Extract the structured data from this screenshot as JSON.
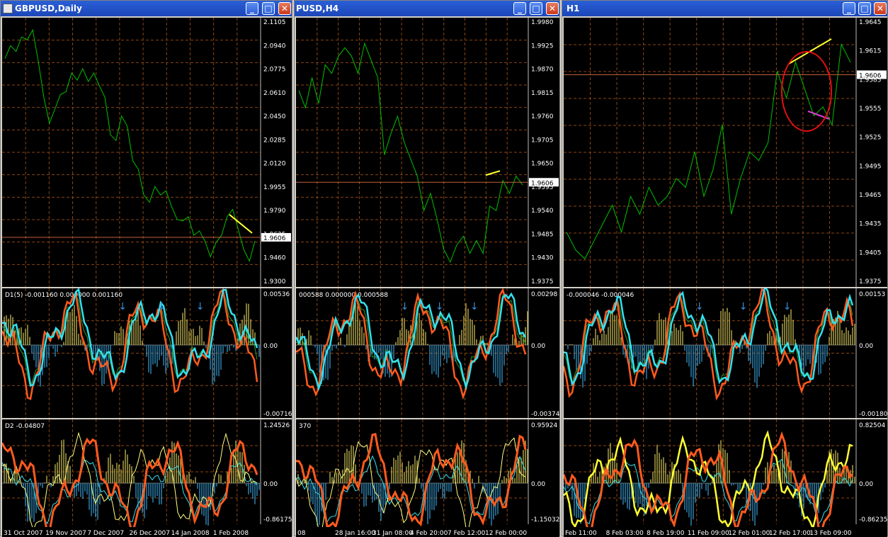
{
  "windows": [
    {
      "title": "GBPUSD,Daily",
      "price_axis": [
        "2.1105",
        "2.0940",
        "2.0775",
        "2.0610",
        "2.0450",
        "2.0285",
        "2.0120",
        "1.9955",
        "1.9790",
        "1.9625",
        "1.9460",
        "1.9300"
      ],
      "current_price": "1.9606",
      "ind1": {
        "label": "D1(5) -0.001160 0.000000 0.001160",
        "top": "0.00536",
        "zero": "0.00",
        "bottom": "-0.00716"
      },
      "ind2": {
        "label": "D2 -0.04807",
        "top": "1.24526",
        "zero": "0.00",
        "bottom": "-0.86175"
      },
      "time_axis": [
        "31 Oct 2007",
        "19 Nov 2007",
        "7 Dec 2007",
        "26 Dec 2007",
        "14 Jan 2008",
        "1 Feb 2008"
      ]
    },
    {
      "title": "PUSD,H4",
      "price_axis": [
        "1.9980",
        "1.9925",
        "1.9870",
        "1.9815",
        "1.9760",
        "1.9705",
        "1.9650",
        "1.9595",
        "1.9540",
        "1.9485",
        "1.9430",
        "1.9375"
      ],
      "current_price": "1.9606",
      "ind1": {
        "label": "000588 0.000000 0.000588",
        "top": "0.00298",
        "zero": "0.00",
        "bottom": "-0.00374"
      },
      "ind2": {
        "label": "370",
        "top": "0.95924",
        "zero": "0.00",
        "bottom": "-1.15032"
      },
      "time_axis": [
        "08",
        "28 Jan 16:00",
        "31 Jan 08:00",
        "4 Feb 20:00",
        "7 Feb 12:00",
        "12 Feb 00:00"
      ]
    },
    {
      "title": "H1",
      "price_axis": [
        "1.9645",
        "1.9615",
        "1.9585",
        "1.9555",
        "1.9525",
        "1.9495",
        "1.9465",
        "1.9435",
        "1.9405",
        "1.9375"
      ],
      "current_price": "1.9606",
      "ind1": {
        "label": "-0.000046 -0.000046",
        "top": "0.00153",
        "zero": "0.00",
        "bottom": "-0.00180"
      },
      "ind2": {
        "label": "",
        "top": "0.82504",
        "zero": "0.00",
        "bottom": "-0.86235"
      },
      "time_axis": [
        "Feb 11:00",
        "8 Feb 03:00",
        "8 Feb 19:00",
        "11 Feb 09:00",
        "12 Feb 01:00",
        "12 Feb 17:00",
        "13 Feb 09:00"
      ]
    }
  ],
  "colors": {
    "price": "#00c000",
    "grid": "#8b4513",
    "hist_pos": "#d4c85a",
    "hist_neg": "#3aa0d8",
    "cyan": "#33e0ee",
    "orange": "#ff5a1e",
    "yellow": "#ffff33",
    "magenta": "#e040e0",
    "red_circle": "#e01010",
    "arrow": "#3a8de0"
  },
  "chart_data": [
    {
      "type": "line",
      "title": "GBPUSD,Daily",
      "ylim": [
        1.93,
        2.1105
      ],
      "values": [
        2.085,
        2.094,
        2.09,
        2.1,
        2.098,
        2.105,
        2.083,
        2.058,
        2.04,
        2.05,
        2.06,
        2.062,
        2.075,
        2.07,
        2.078,
        2.069,
        2.075,
        2.066,
        2.058,
        2.032,
        2.028,
        2.045,
        2.038,
        2.014,
        2.008,
        1.99,
        1.985,
        1.996,
        1.99,
        1.993,
        1.982,
        1.973,
        1.972,
        1.975,
        1.962,
        1.965,
        1.958,
        1.947,
        1.957,
        1.962,
        1.975,
        1.98,
        1.966,
        1.952,
        1.944,
        1.958
      ],
      "current": 1.9606
    },
    {
      "type": "line",
      "title": "PUSD,H4",
      "ylim": [
        1.9375,
        1.998
      ],
      "values": [
        1.982,
        1.978,
        1.985,
        1.979,
        1.988,
        1.986,
        1.99,
        1.992,
        1.99,
        1.986,
        1.993,
        1.989,
        1.985,
        1.967,
        1.972,
        1.976,
        1.97,
        1.966,
        1.962,
        1.954,
        1.958,
        1.952,
        1.945,
        1.942,
        1.946,
        1.948,
        1.944,
        1.947,
        1.944,
        1.955,
        1.954,
        1.961,
        1.958,
        1.962,
        1.96
      ],
      "current": 1.9606
    },
    {
      "type": "line",
      "title": "H1",
      "ylim": [
        1.9375,
        1.9665
      ],
      "values": [
        1.943,
        1.941,
        1.94,
        1.942,
        1.944,
        1.946,
        1.943,
        1.947,
        1.945,
        1.948,
        1.946,
        1.947,
        1.949,
        1.948,
        1.952,
        1.947,
        1.95,
        1.955,
        1.945,
        1.949,
        1.952,
        1.951,
        1.953,
        1.961,
        1.958,
        1.962,
        1.959,
        1.956,
        1.957,
        1.955,
        1.964,
        1.962
      ],
      "current": 1.9606
    }
  ]
}
